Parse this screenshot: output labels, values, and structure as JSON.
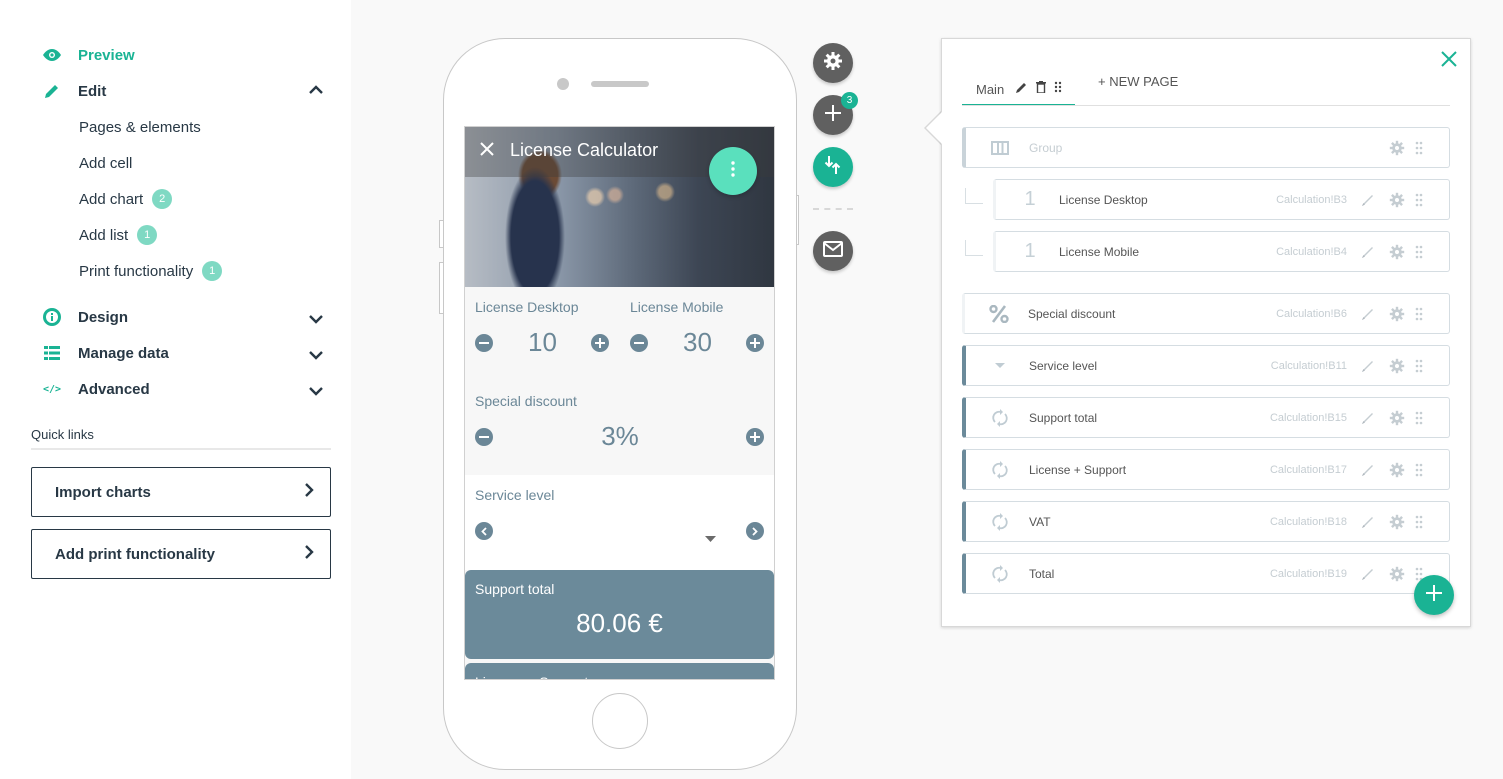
{
  "sidebar": {
    "nav": [
      {
        "label": "Preview",
        "icon": "eye-icon",
        "active": true
      },
      {
        "label": "Edit",
        "icon": "pencil-icon",
        "expanded": true
      },
      {
        "label": "Design",
        "icon": "info-icon",
        "expanded": false
      },
      {
        "label": "Manage data",
        "icon": "list-icon",
        "expanded": false
      },
      {
        "label": "Advanced",
        "icon": "code-icon",
        "expanded": false
      }
    ],
    "edit_items": [
      {
        "label": "Pages & elements"
      },
      {
        "label": "Add cell"
      },
      {
        "label": "Add chart",
        "badge": "2"
      },
      {
        "label": "Add list",
        "badge": "1"
      },
      {
        "label": "Print functionality",
        "badge": "1"
      }
    ],
    "quick_links_title": "Quick links",
    "quick_links": [
      {
        "label": "Import charts"
      },
      {
        "label": "Add print functionality"
      }
    ]
  },
  "phone": {
    "app_title": "License Calculator",
    "fields": {
      "license_desktop": {
        "label": "License Desktop",
        "value": "10"
      },
      "license_mobile": {
        "label": "License Mobile",
        "value": "30"
      },
      "special_discount": {
        "label": "Special discount",
        "value": "3%"
      },
      "service_level": {
        "label": "Service level",
        "value": ""
      }
    },
    "cards": [
      {
        "label": "Support total",
        "value": "80.06 €"
      },
      {
        "label": "License + Support",
        "value": ""
      }
    ]
  },
  "tools": {
    "add_badge": "3"
  },
  "panel": {
    "tab_main": "Main",
    "new_page": "+ NEW PAGE",
    "rows": [
      {
        "name": "Group",
        "ref": "",
        "icon": "columns-icon",
        "type": "group"
      },
      {
        "name": "License Desktop",
        "ref": "Calculation!B3",
        "icon": "number-icon",
        "icon_text": "1",
        "type": "child"
      },
      {
        "name": "License Mobile",
        "ref": "Calculation!B4",
        "icon": "number-icon",
        "icon_text": "1",
        "type": "child"
      },
      {
        "name": "Special discount",
        "ref": "Calculation!B6",
        "icon": "percent-icon",
        "icon_text": "%",
        "type": "light"
      },
      {
        "name": "Service level",
        "ref": "Calculation!B11",
        "icon": "dropdown-icon",
        "type": "accent"
      },
      {
        "name": "Support total",
        "ref": "Calculation!B15",
        "icon": "refresh-icon",
        "type": "accent"
      },
      {
        "name": "License + Support",
        "ref": "Calculation!B17",
        "icon": "refresh-icon",
        "type": "accent"
      },
      {
        "name": "VAT",
        "ref": "Calculation!B18",
        "icon": "refresh-icon",
        "type": "accent"
      },
      {
        "name": "Total",
        "ref": "Calculation!B19",
        "icon": "refresh-icon",
        "type": "accent"
      }
    ]
  },
  "colors": {
    "accent": "#1ab394",
    "text": "#283845",
    "field": "#6b8797",
    "card": "#6b8a9a",
    "badge": "#7fd9c3"
  }
}
